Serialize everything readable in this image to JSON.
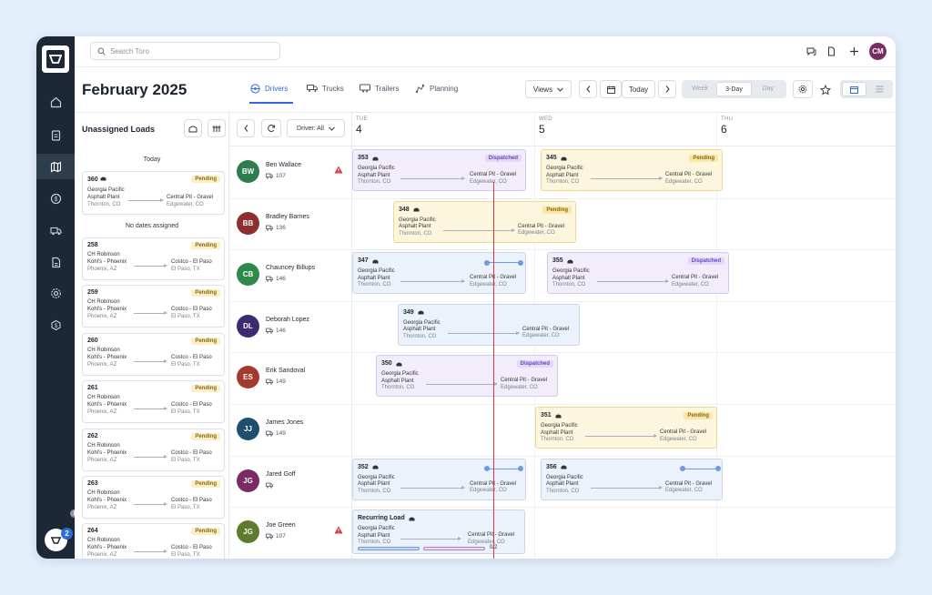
{
  "search": {
    "placeholder": "Search Toro"
  },
  "topbar": {
    "avatar_initials": "CM"
  },
  "rail": {
    "items": [
      "home-icon",
      "clipboard-icon",
      "map-icon",
      "dollar-icon",
      "truck-icon",
      "document-icon",
      "gear-icon",
      "dollar-circle-icon"
    ],
    "active_index": 2,
    "notification_count": "2",
    "status_count": "1"
  },
  "header": {
    "title": "February 2025"
  },
  "tabs": [
    {
      "label": "Drivers",
      "active": true
    },
    {
      "label": "Trucks",
      "active": false
    },
    {
      "label": "Trailers",
      "active": false
    },
    {
      "label": "Planning",
      "active": false
    }
  ],
  "controls": {
    "views_label": "Views",
    "today_label": "Today",
    "view_modes": [
      "Week",
      "3-Day",
      "Day"
    ],
    "active_view_mode": "3-Day"
  },
  "unassigned": {
    "title": "Unassigned Loads",
    "today_header": "Today",
    "today_load": {
      "id": "360",
      "status": "Pending",
      "line1": "Georgia Pacific",
      "from": "Asphalt Plant",
      "from_city": "Thornton, CO",
      "to": "Central Pit - Gravel",
      "to_city": "Edgewater, CO"
    },
    "nodates_header": "No dates assigned",
    "loads": [
      {
        "id": "258",
        "status": "Pending",
        "line1": "CH Robinson",
        "from": "Kohl's - Phoenix",
        "from_city": "Phoenix, AZ",
        "to": "Costco - El Paso",
        "to_city": "El Paso, TX"
      },
      {
        "id": "259",
        "status": "Pending",
        "line1": "CH Robinson",
        "from": "Kohl's - Phoenix",
        "from_city": "Phoenix, AZ",
        "to": "Costco - El Paso",
        "to_city": "El Paso, TX"
      },
      {
        "id": "260",
        "status": "Pending",
        "line1": "CH Robinson",
        "from": "Kohl's - Phoenix",
        "from_city": "Phoenix, AZ",
        "to": "Costco - El Paso",
        "to_city": "El Paso, TX"
      },
      {
        "id": "261",
        "status": "Pending",
        "line1": "CH Robinson",
        "from": "Kohl's - Phoenix",
        "from_city": "Phoenix, AZ",
        "to": "Costco - El Paso",
        "to_city": "El Paso, TX"
      },
      {
        "id": "262",
        "status": "Pending",
        "line1": "CH Robinson",
        "from": "Kohl's - Phoenix",
        "from_city": "Phoenix, AZ",
        "to": "Costco - El Paso",
        "to_city": "El Paso, TX"
      },
      {
        "id": "263",
        "status": "Pending",
        "line1": "CH Robinson",
        "from": "Kohl's - Phoenix",
        "from_city": "Phoenix, AZ",
        "to": "Costco - El Paso",
        "to_city": "El Paso, TX"
      },
      {
        "id": "264",
        "status": "Pending",
        "line1": "CH Robinson",
        "from": "Kohl's - Phoenix",
        "from_city": "Phoenix, AZ",
        "to": "Costco - El Paso",
        "to_city": "El Paso, TX"
      }
    ]
  },
  "calendar": {
    "driver_filter": "Driver: All",
    "days": [
      {
        "dow": "TUE",
        "num": "4"
      },
      {
        "dow": "WED",
        "num": "5"
      },
      {
        "dow": "THU",
        "num": "6"
      }
    ],
    "drivers": [
      {
        "initials": "BW",
        "name": "Ben Wallace",
        "truck": "107",
        "color": "#2e7d4f",
        "warning": true
      },
      {
        "initials": "BB",
        "name": "Bradley Barnes",
        "truck": "136",
        "color": "#8e2f2f",
        "warning": false
      },
      {
        "initials": "CB",
        "name": "Chauncey Billups",
        "truck": "146",
        "color": "#2e8a4a",
        "warning": false
      },
      {
        "initials": "DL",
        "name": "Deborah Lopez",
        "truck": "146",
        "color": "#3e2a73",
        "warning": false
      },
      {
        "initials": "ES",
        "name": "Erik Sandoval",
        "truck": "149",
        "color": "#a33a2c",
        "warning": false
      },
      {
        "initials": "JJ",
        "name": "James Jones",
        "truck": "149",
        "color": "#1f4f6e",
        "warning": false
      },
      {
        "initials": "JG",
        "name": "Jared Goff",
        "truck": "",
        "color": "#7a2c62",
        "warning": false
      },
      {
        "initials": "JG",
        "name": "Joe Green",
        "truck": "107",
        "color": "#5e7a2c",
        "warning": true
      }
    ],
    "loads": [
      {
        "row": 0,
        "id": "353",
        "status": "Dispatched",
        "kind": "disp",
        "line1": "Georgia Pacific",
        "from": "Asphalt Plant",
        "from_city": "Thornton, CO",
        "to": "Central Pit - Gravel",
        "to_city": "Edgewater, CO"
      },
      {
        "row": 0,
        "id": "345",
        "status": "Pending",
        "kind": "pend",
        "line1": "Georgia Pacific",
        "from": "Asphalt Plant",
        "from_city": "Thornton, CO",
        "to": "Central Pit - Gravel",
        "to_city": "Edgewater, CO"
      },
      {
        "row": 1,
        "id": "348",
        "status": "Pending",
        "kind": "pend",
        "line1": "Georgia Pacific",
        "from": "Asphalt Plant",
        "from_city": "Thornton, CO",
        "to": "Central Pit - Gravel",
        "to_city": "Edgewater, CO"
      },
      {
        "row": 2,
        "id": "347",
        "status": "",
        "kind": "track",
        "line1": "Georgia Pacific",
        "from": "Asphalt Plant",
        "from_city": "Thornton, CO",
        "to": "Central Pit - Gravel",
        "to_city": "Edgewater, CO"
      },
      {
        "row": 2,
        "id": "355",
        "status": "Dispatched",
        "kind": "disp",
        "line1": "Georgia Pacific",
        "from": "Asphalt Plant",
        "from_city": "Thornton, CO",
        "to": "Central Pit - Gravel",
        "to_city": "Edgewater, CO"
      },
      {
        "row": 3,
        "id": "349",
        "status": "",
        "kind": "blue",
        "line1": "Georgia Pacific",
        "from": "Asphalt Plant",
        "from_city": "Thornton, CO",
        "to": "Central Pit - Gravel",
        "to_city": "Edgewater, CO"
      },
      {
        "row": 4,
        "id": "350",
        "status": "Dispatched",
        "kind": "disp",
        "line1": "Georgia Pacific",
        "from": "Asphalt Plant",
        "from_city": "Thornton, CO",
        "to": "Central Pit - Gravel",
        "to_city": "Edgewater, CO"
      },
      {
        "row": 5,
        "id": "351",
        "status": "Pending",
        "kind": "pend",
        "line1": "Georgia Pacific",
        "from": "Asphalt Plant",
        "from_city": "Thornton, CO",
        "to": "Central Pit - Gravel",
        "to_city": "Edgewater, CO"
      },
      {
        "row": 6,
        "id": "352",
        "status": "",
        "kind": "track",
        "line1": "Georgia Pacific",
        "from": "Asphalt Plant",
        "from_city": "Thornton, CO",
        "to": "Central Pit - Gravel",
        "to_city": "Edgewater, CO"
      },
      {
        "row": 6,
        "id": "356",
        "status": "",
        "kind": "track",
        "line1": "Georgia Pacific",
        "from": "Asphalt Plant",
        "from_city": "Thornton, CO",
        "to": "Central Pit - Gravel",
        "to_city": "Edgewater, CO"
      },
      {
        "row": 7,
        "id": "Recurring Load",
        "status": "",
        "kind": "recurring",
        "line1": "Georgia Pacific",
        "from": "Asphalt Plant",
        "from_city": "Thornton, CO",
        "to": "Central Pit - Gravel",
        "to_city": "Edgewater, CO",
        "progress_text": "0/2"
      }
    ]
  },
  "colors": {
    "accent": "#2f6bd8",
    "now_line": "#d9363e",
    "rail_bg": "#1c2836"
  }
}
